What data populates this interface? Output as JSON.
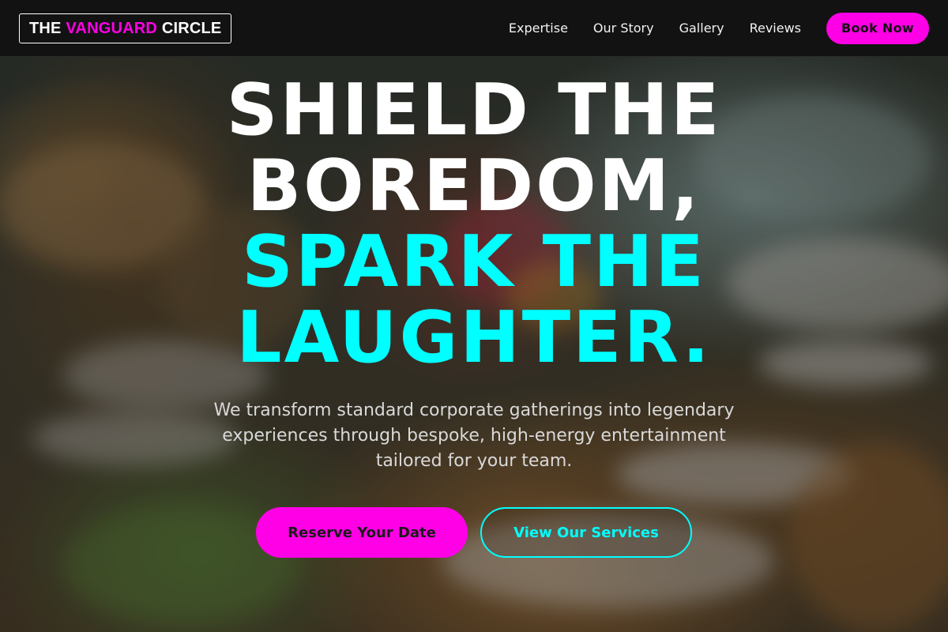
{
  "brand": {
    "part1": "THE",
    "part2": "VANGUARD",
    "part3": "CIRCLE"
  },
  "nav": {
    "items": [
      {
        "label": "Expertise"
      },
      {
        "label": "Our Story"
      },
      {
        "label": "Gallery"
      },
      {
        "label": "Reviews"
      }
    ],
    "cta_label": "Book Now"
  },
  "hero": {
    "headline_line1": "SHIELD THE",
    "headline_line2": "BOREDOM,",
    "headline_line3": "SPARK THE",
    "headline_line4": "LAUGHTER.",
    "subtitle": "We transform standard corporate gatherings into legendary experiences through bespoke, high-energy entertainment tailored for your team.",
    "primary_cta": "Reserve Your Date",
    "secondary_cta": "View Our Services",
    "background_image": "blurred banquet table with glassware and flowers"
  },
  "colors": {
    "accent_magenta": "#ff00e6",
    "accent_cyan": "#00ffff",
    "header_bg": "#121212"
  }
}
